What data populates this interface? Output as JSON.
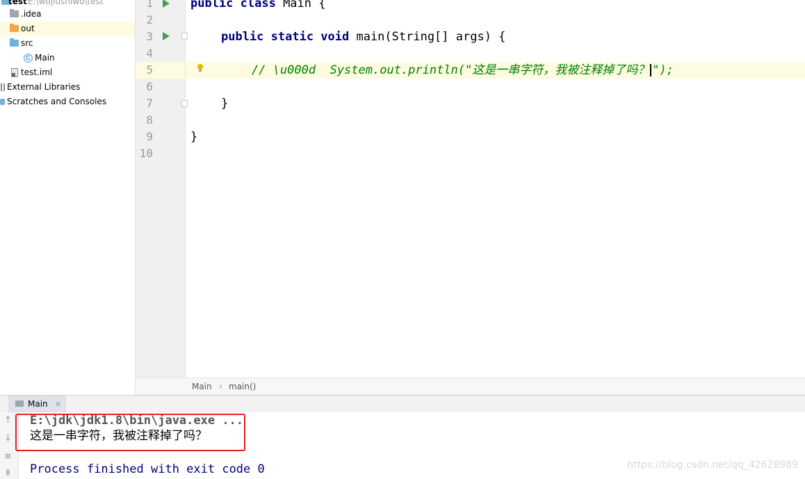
{
  "project": {
    "root_label": "test",
    "root_path": "E:\\wojiushiwo\\test",
    "items": [
      {
        "label": ".idea",
        "icon": "folder-icon"
      },
      {
        "label": "out",
        "icon": "folder-orange-icon"
      },
      {
        "label": "src",
        "icon": "folder-source-icon"
      },
      {
        "label": "Main",
        "icon": "java-class-icon"
      },
      {
        "label": "test.iml",
        "icon": "module-file-icon"
      },
      {
        "label": "External Libraries",
        "icon": "library-icon"
      },
      {
        "label": "Scratches and Consoles",
        "icon": "scratches-icon"
      }
    ]
  },
  "editor": {
    "line_numbers": [
      "1",
      "2",
      "3",
      "4",
      "5",
      "6",
      "7",
      "8",
      "9",
      "10"
    ],
    "code": {
      "l1_kw": "public class",
      "l1_rest": " Main {",
      "l3_kw": "public static void",
      "l3_rest": " main(String[] args) {",
      "l5_comment": "// \\u000d  System.out.println(\"这是一串字符，我被注释掉了吗？",
      "l5_tail": "\");",
      "l7": "}",
      "l9": "}"
    }
  },
  "breadcrumb": {
    "items": [
      "Main",
      "main()"
    ],
    "separator": "›"
  },
  "run_panel": {
    "tab_label": "Main",
    "close_glyph": "×",
    "console_lines": [
      "E:\\jdk\\jdk1.8\\bin\\java.exe ...",
      "这是一串字符，我被注释掉了吗？",
      "Process finished with exit code 0"
    ]
  },
  "watermark": "https://blog.csdn.net/qq_42628989",
  "colors": {
    "keyword": "#000080",
    "comment": "#808080",
    "current_line": "#fdfbe0",
    "run_arrow": "#499c54",
    "highlight_box": "#e02020"
  }
}
